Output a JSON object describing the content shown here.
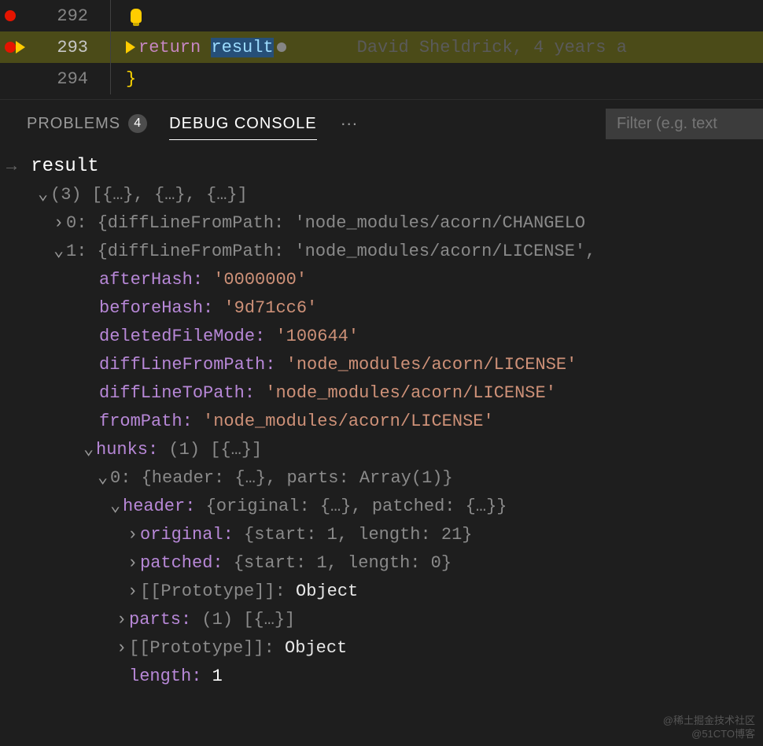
{
  "editor": {
    "lines": [
      {
        "num": "292"
      },
      {
        "num": "293",
        "kw": "return",
        "var": "result"
      },
      {
        "num": "294",
        "brace": "}"
      }
    ],
    "blame": "David Sheldrick, 4 years a"
  },
  "panel": {
    "tabs": {
      "problems": {
        "label": "PROBLEMS",
        "badge": "4"
      },
      "debug": {
        "label": "DEBUG CONSOLE"
      }
    },
    "filter_placeholder": "Filter (e.g. text"
  },
  "console": {
    "input": "result",
    "summary": "(3) [{…}, {…}, {…}]",
    "item0": {
      "idx": "0:",
      "preview": "{diffLineFromPath: 'node_modules/acorn/CHANGELO"
    },
    "item1": {
      "idx": "1:",
      "preview": "{diffLineFromPath: 'node_modules/acorn/LICENSE',",
      "afterHash": {
        "k": "afterHash:",
        "v": "'0000000'"
      },
      "beforeHash": {
        "k": "beforeHash:",
        "v": "'9d71cc6'"
      },
      "deletedFileMode": {
        "k": "deletedFileMode:",
        "v": "'100644'"
      },
      "diffLineFromPath": {
        "k": "diffLineFromPath:",
        "v": "'node_modules/acorn/LICENSE'"
      },
      "diffLineToPath": {
        "k": "diffLineToPath:",
        "v": "'node_modules/acorn/LICENSE'"
      },
      "fromPath": {
        "k": "fromPath:",
        "v": "'node_modules/acorn/LICENSE'"
      },
      "hunks": {
        "k": "hunks:",
        "preview": "(1) [{…}]",
        "item0": {
          "idx": "0:",
          "preview": "{header: {…}, parts: Array(1)}",
          "header": {
            "k": "header:",
            "preview": "{original: {…}, patched: {…}}",
            "original": {
              "k": "original:",
              "v": "{start: 1, length: 21}"
            },
            "patched": {
              "k": "patched:",
              "v": "{start: 1, length: 0}"
            },
            "proto": {
              "k": "[[Prototype]]:",
              "v": "Object"
            }
          },
          "parts": {
            "k": "parts:",
            "v": "(1) [{…}]"
          },
          "proto": {
            "k": "[[Prototype]]:",
            "v": "Object"
          }
        },
        "length": {
          "k": "length:",
          "v": "1"
        }
      }
    }
  },
  "watermark": {
    "line1": "@稀土掘金技术社区",
    "line2": "@51CTO博客"
  }
}
